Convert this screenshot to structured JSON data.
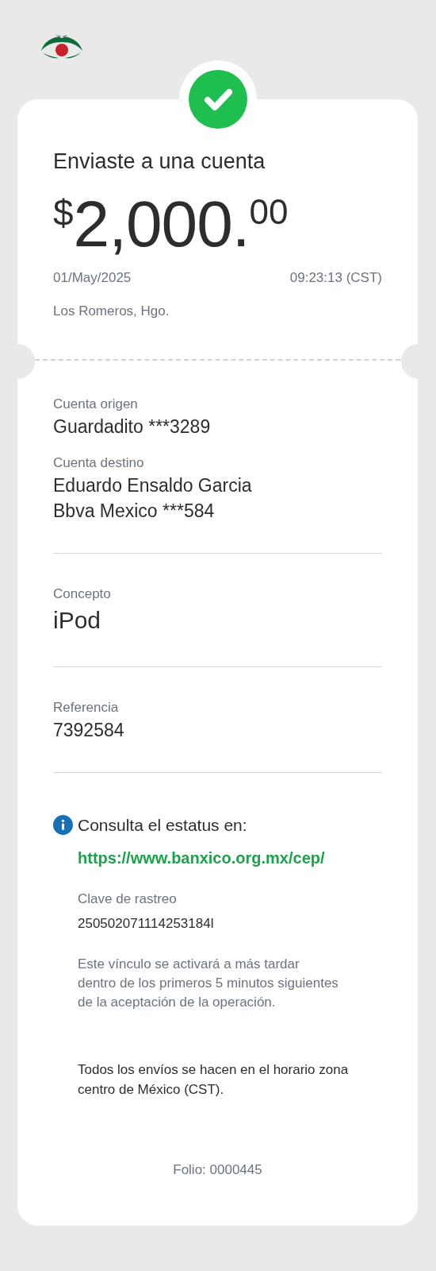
{
  "header": {
    "title": "Enviaste a una cuenta",
    "currency": "$",
    "whole": "2,000.",
    "cents": "00",
    "date": "01/May/2025",
    "time": "09:23:13 (CST)",
    "location": "Los Romeros, Hgo."
  },
  "sections": [
    {
      "fields": [
        {
          "kind": "normal",
          "label": "Cuenta origen",
          "lines": [
            "Guardadito ***3289"
          ]
        },
        {
          "kind": "normal",
          "label": "Cuenta destino",
          "lines": [
            "Eduardo Ensaldo Garcia",
            "Bbva Mexico ***584"
          ]
        }
      ]
    },
    {
      "fields": [
        {
          "kind": "large",
          "label": "Concepto",
          "lines": [
            "iPod"
          ]
        }
      ]
    },
    {
      "fields": [
        {
          "kind": "normal",
          "label": "Referencia",
          "lines": [
            "7392584"
          ]
        }
      ]
    }
  ],
  "info": {
    "text": "Consulta el estatus en:",
    "link": "https://www.banxico.org.mx/cep/",
    "tracking_label": "Clave de rastreo",
    "tracking_code": "250502071114253184l",
    "note": "Este vínculo se activará a más tardar dentro de los primeros 5 minutos siguientes de la aceptación de la operación."
  },
  "schedule_note": "Todos los envíos se hacen en el horario zona centro de México (CST).",
  "folio": "Folio: 0000445"
}
